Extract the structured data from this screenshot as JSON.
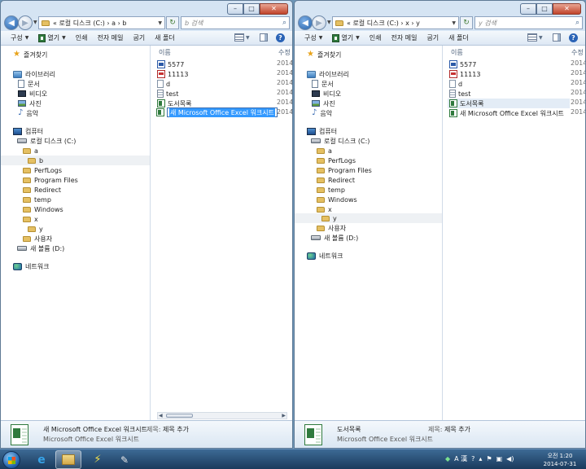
{
  "left": {
    "breadcrumb": "« 로컬 디스크 (C:) › a › b",
    "search_placeholder": "b 검색",
    "toolbar": [
      "구성",
      "열기",
      "인쇄",
      "전자 메일",
      "굽기",
      "새 폴더"
    ],
    "nav": {
      "favorites": "즐겨찾기",
      "libraries": "라이브러리",
      "documents": "문서",
      "videos": "비디오",
      "pictures": "사진",
      "music": "음악",
      "computer": "컴퓨터",
      "local_disk": "로컬 디스크 (C:)",
      "folders": [
        "a",
        "b",
        "PerfLogs",
        "Program Files",
        "Redirect",
        "temp",
        "Windows",
        "x",
        "y",
        "사용자"
      ],
      "new_volume": "새 볼륨 (D:)",
      "network": "네트워크"
    },
    "columns": {
      "name": "이름",
      "modified": "수정"
    },
    "files": [
      {
        "name": "5577",
        "date": "2014"
      },
      {
        "name": "11113",
        "date": "2014"
      },
      {
        "name": "d",
        "date": "2014"
      },
      {
        "name": "test",
        "date": "2014"
      },
      {
        "name": "도서목록",
        "date": "2014"
      },
      {
        "name": "새 Microsoft Office Excel 워크시트",
        "date": "2014"
      }
    ],
    "details": {
      "name": "새 Microsoft Office Excel 워크시트",
      "type": "Microsoft Office Excel 워크시트",
      "title_label": "제목:",
      "title_value": "제목 추가"
    }
  },
  "right": {
    "breadcrumb": "« 로컬 디스크 (C:) › x › y",
    "search_placeholder": "y 검색",
    "toolbar": [
      "구성",
      "열기",
      "인쇄",
      "전자 메일",
      "굽기",
      "새 폴더"
    ],
    "nav": {
      "favorites": "즐겨찾기",
      "libraries": "라이브러리",
      "documents": "문서",
      "videos": "비디오",
      "pictures": "사진",
      "music": "음악",
      "computer": "컴퓨터",
      "local_disk": "로컬 디스크 (C:)",
      "folders": [
        "a",
        "PerfLogs",
        "Program Files",
        "Redirect",
        "temp",
        "Windows",
        "x",
        "y",
        "사용자"
      ],
      "new_volume": "새 볼륨 (D:)",
      "network": "네트워크"
    },
    "columns": {
      "name": "이름",
      "modified": "수정"
    },
    "files": [
      {
        "name": "5577",
        "date": "2014"
      },
      {
        "name": "11113",
        "date": "2014"
      },
      {
        "name": "d",
        "date": "2014"
      },
      {
        "name": "test",
        "date": "2014"
      },
      {
        "name": "도서목록",
        "date": "2014"
      },
      {
        "name": "새 Microsoft Office Excel 워크시트",
        "date": "2014"
      }
    ],
    "details": {
      "name": "도서목록",
      "type": "Microsoft Office Excel 워크시트",
      "title_label": "제목:",
      "title_value": "제목 추가"
    }
  },
  "taskbar": {
    "tray_ime": "A 漢",
    "time": "오전 1:20",
    "date": "2014-07-31"
  },
  "colors": {
    "selection": "#3399ff",
    "window_frame": "#d5e4f3",
    "taskbar": "#1a3a5c"
  }
}
